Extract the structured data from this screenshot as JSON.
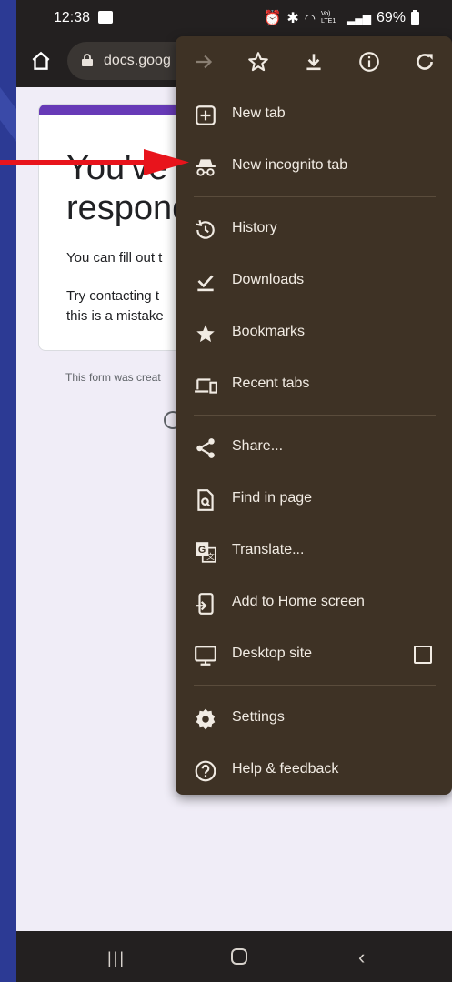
{
  "status_bar": {
    "time": "12:38",
    "battery": "69%",
    "network": "Vo) LTE1"
  },
  "url_bar": {
    "url_text": "docs.goog"
  },
  "page": {
    "heading_line1": "You've",
    "heading_line2": "respond",
    "p1": "You can fill out t",
    "p2_line1": "Try contacting t",
    "p2_line2": "this is a mistake",
    "footer": "This form was creat",
    "card_accent": "#673ab7"
  },
  "menu": {
    "toolbar": [
      {
        "name": "forward-icon"
      },
      {
        "name": "star-icon"
      },
      {
        "name": "download-icon"
      },
      {
        "name": "info-icon"
      },
      {
        "name": "refresh-icon"
      }
    ],
    "items": [
      {
        "label": "New tab",
        "icon": "new-tab-icon"
      },
      {
        "label": "New incognito tab",
        "icon": "incognito-icon"
      },
      {
        "label": "History",
        "icon": "history-icon"
      },
      {
        "label": "Downloads",
        "icon": "downloads-icon"
      },
      {
        "label": "Bookmarks",
        "icon": "bookmarks-icon"
      },
      {
        "label": "Recent tabs",
        "icon": "recent-tabs-icon"
      },
      {
        "label": "Share...",
        "icon": "share-icon"
      },
      {
        "label": "Find in page",
        "icon": "find-in-page-icon"
      },
      {
        "label": "Translate...",
        "icon": "translate-icon"
      },
      {
        "label": "Add to Home screen",
        "icon": "add-to-home-icon"
      },
      {
        "label": "Desktop site",
        "icon": "desktop-icon"
      },
      {
        "label": "Settings",
        "icon": "settings-icon"
      },
      {
        "label": "Help & feedback",
        "icon": "help-icon"
      }
    ],
    "background": "#3e3225",
    "text_color": "#f1ebe3"
  },
  "annotation": {
    "arrow_color": "#e8141c"
  }
}
